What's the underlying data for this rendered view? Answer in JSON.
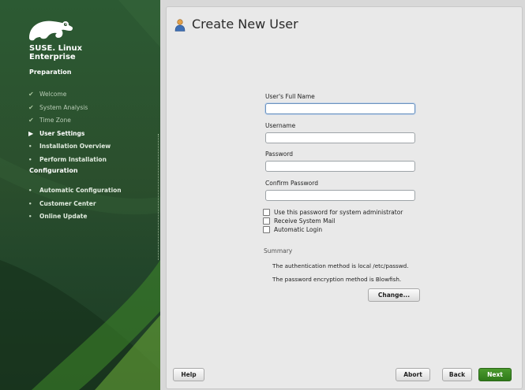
{
  "sidebar": {
    "brand_line1": "SUSE. Linux",
    "brand_line2": "Enterprise",
    "sections": [
      {
        "title": "Preparation",
        "steps": [
          {
            "label": "Welcome",
            "state": "done"
          },
          {
            "label": "System Analysis",
            "state": "done"
          },
          {
            "label": "Time Zone",
            "state": "done"
          },
          {
            "label": "User Settings",
            "state": "current"
          },
          {
            "label": "Installation Overview",
            "state": "todo"
          },
          {
            "label": "Perform Installation",
            "state": "todo"
          }
        ]
      },
      {
        "title": "Configuration",
        "steps": [
          {
            "label": "Automatic Configuration",
            "state": "todo"
          },
          {
            "label": "Customer Center",
            "state": "todo"
          },
          {
            "label": "Online Update",
            "state": "todo"
          }
        ]
      }
    ],
    "markers": {
      "done": "✔",
      "current": "▶",
      "todo": "•"
    }
  },
  "page": {
    "title": "Create New User",
    "icon": "user-icon"
  },
  "form": {
    "full_name_label": "User's Full Name",
    "full_name_value": "",
    "username_label": "Username",
    "username_value": "",
    "password_label": "Password",
    "password_value": "",
    "confirm_label": "Confirm Password",
    "confirm_value": "",
    "check_admin_label": "Use this password for system administrator",
    "check_mail_label": "Receive System Mail",
    "check_autologin_label": "Automatic Login"
  },
  "summary": {
    "title": "Summary",
    "line1": "The authentication method is local /etc/passwd.",
    "line2": "The password encryption method is Blowfish.",
    "change_label": "Change..."
  },
  "buttons": {
    "help": "Help",
    "abort": "Abort",
    "back": "Back",
    "next": "Next"
  },
  "colors": {
    "sidebar": "#2b4f2d",
    "accent": "#3d8a24"
  }
}
